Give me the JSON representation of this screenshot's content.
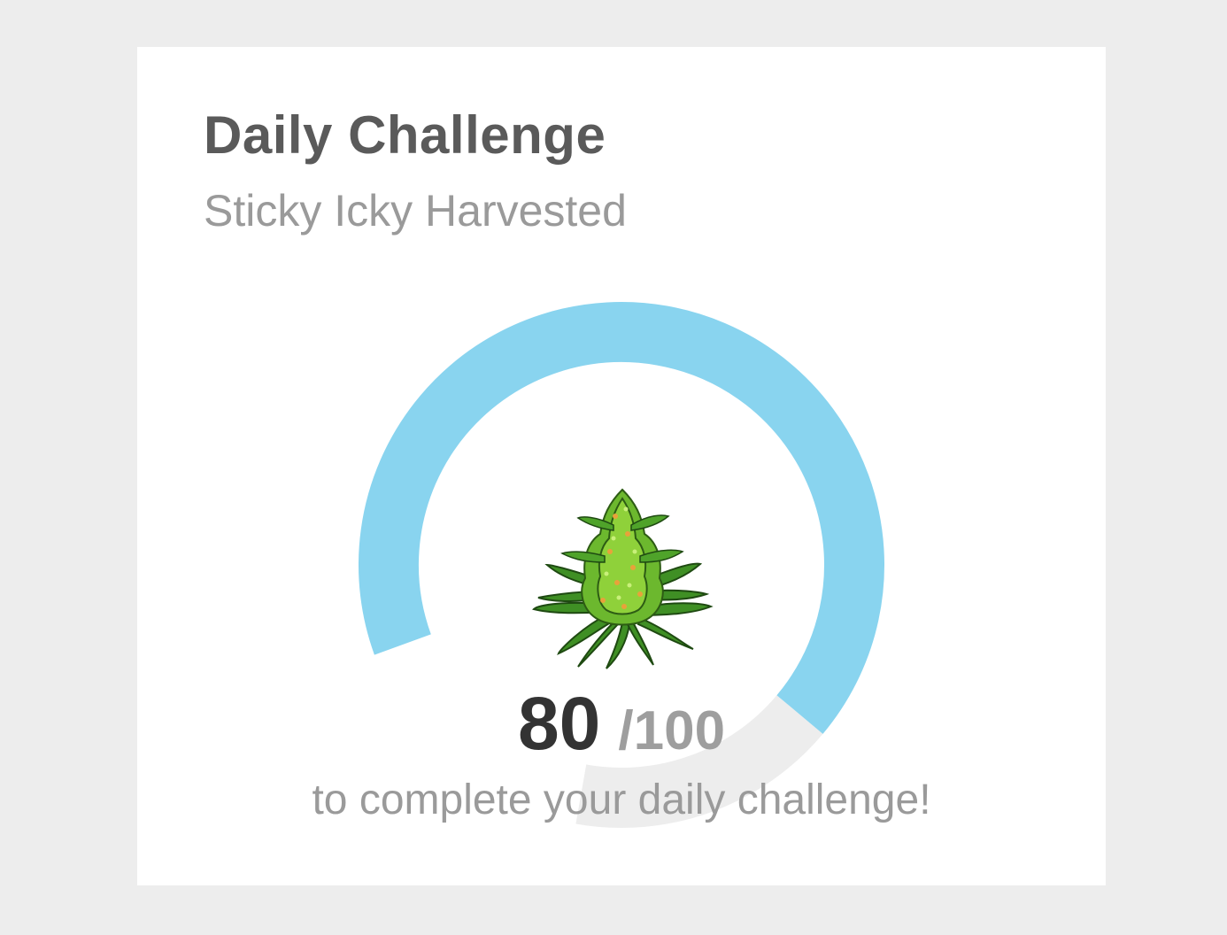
{
  "card": {
    "title": "Daily Challenge",
    "subtitle": "Sticky Icky Harvested"
  },
  "gauge": {
    "current": 80,
    "max": 100,
    "fill_fraction": 0.8,
    "fill_color": "#89d4ef",
    "track_color": "#ededed",
    "center_image": "cannabis-plant-icon"
  },
  "score": {
    "value": "80",
    "total": "/100"
  },
  "caption": "to complete your daily challenge!"
}
